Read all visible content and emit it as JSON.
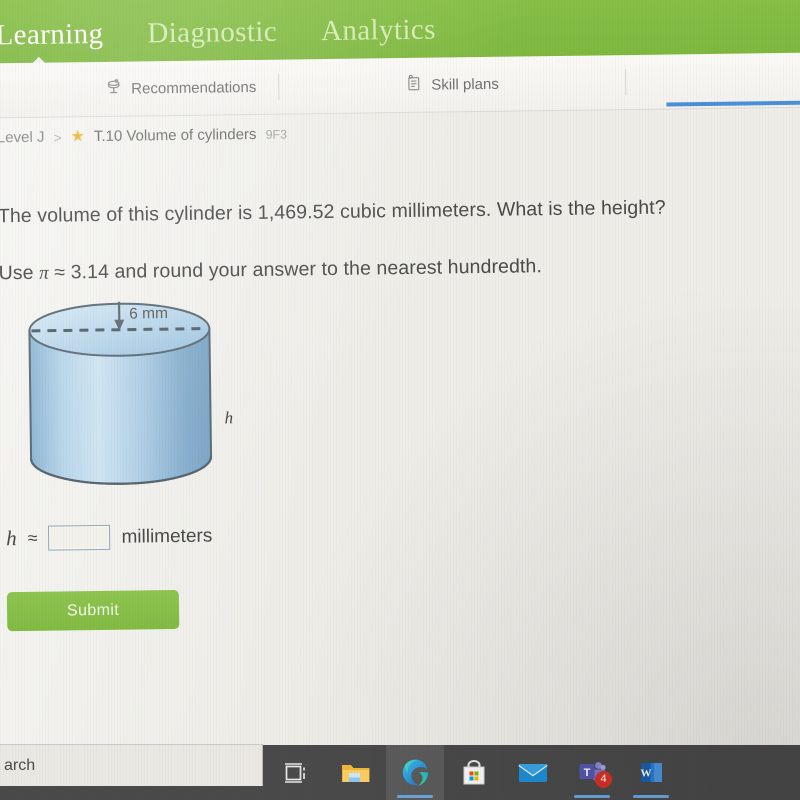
{
  "top_nav": {
    "items": [
      {
        "label": "Learning",
        "active": true
      },
      {
        "label": "Diagnostic",
        "active": false
      },
      {
        "label": "Analytics",
        "active": false
      }
    ],
    "bar_color": "#84bd44",
    "active_color": "#ffffff",
    "inactive_color": "#d6eab4"
  },
  "sub_nav": {
    "tabs": [
      {
        "label": "Recommendations",
        "icon": "recommendations-icon"
      },
      {
        "label": "Skill plans",
        "icon": "skill-plans-icon"
      }
    ],
    "awards": {
      "icon": "diamond-icon",
      "accent_color": "#4a90d9"
    }
  },
  "breadcrumb": {
    "level": "Level J",
    "separator": ">",
    "star_icon": "star-icon",
    "skill_title": "T.10 Volume of cylinders",
    "skill_code": "9F3",
    "star_color": "#f0b536"
  },
  "question": {
    "line1": "The volume of this cylinder is 1,469.52 cubic millimeters. What is the height?",
    "line2_before": "Use",
    "line2_pi": "π",
    "line2_after": "≈ 3.14 and round your answer to the nearest hundredth.",
    "volume_value": "1,469.52",
    "volume_unit": "cubic millimeters",
    "pi_value": "3.14",
    "rounding": "nearest hundredth"
  },
  "figure": {
    "shape": "cylinder",
    "diameter_label": "6 mm",
    "diameter_value": 6,
    "diameter_unit": "mm",
    "height_label": "h",
    "fill_light": "#cfe2f0",
    "fill_mid": "#a7c8e0",
    "fill_dark": "#7fa9c9",
    "stroke": "#5b6b75",
    "dash_line": "dashed-diameter-line",
    "arrow": "dimension-arrow"
  },
  "answer": {
    "variable": "h",
    "approx_symbol": "≈",
    "value": "",
    "placeholder": "",
    "unit": "millimeters",
    "border_color": "#93aabb"
  },
  "submit": {
    "label": "Submit",
    "color": "#84bd44"
  },
  "taskbar": {
    "search_text": "arch",
    "background": "#4a4a4a",
    "items": [
      {
        "name": "task-view-icon",
        "label": "Task View",
        "active": false,
        "underline": false,
        "badge": ""
      },
      {
        "name": "file-explorer-icon",
        "label": "File Explorer",
        "active": false,
        "underline": false,
        "badge": ""
      },
      {
        "name": "microsoft-edge-icon",
        "label": "Microsoft Edge",
        "active": true,
        "underline": true,
        "badge": ""
      },
      {
        "name": "microsoft-store-icon",
        "label": "Microsoft Store",
        "active": false,
        "underline": false,
        "badge": ""
      },
      {
        "name": "mail-icon",
        "label": "Mail",
        "active": false,
        "underline": false,
        "badge": ""
      },
      {
        "name": "microsoft-teams-icon",
        "label": "Microsoft Teams",
        "active": false,
        "underline": true,
        "badge": "4"
      },
      {
        "name": "microsoft-word-icon",
        "label": "Microsoft Word",
        "active": false,
        "underline": true,
        "badge": ""
      }
    ]
  }
}
